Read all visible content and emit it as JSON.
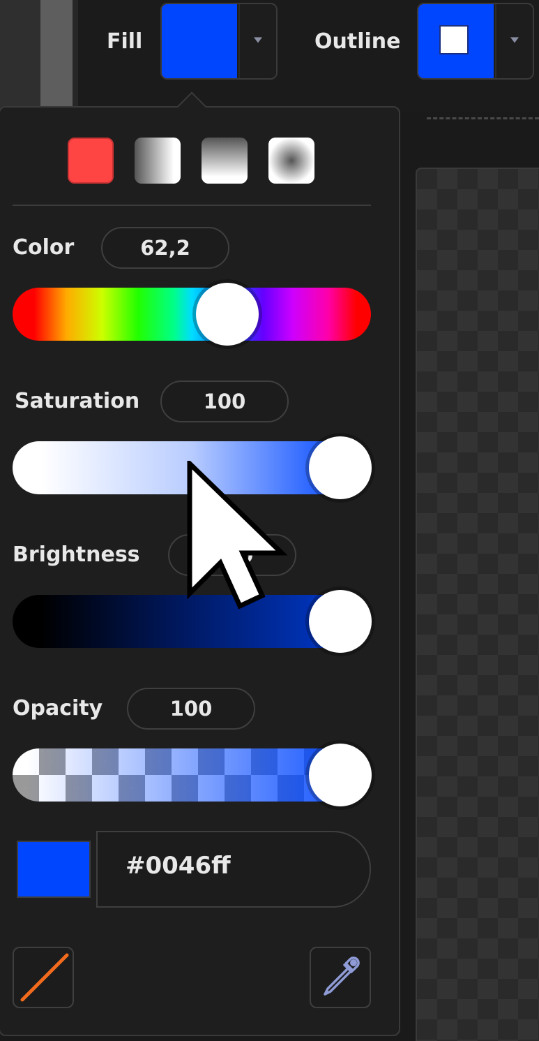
{
  "toolbar": {
    "fill_label": "Fill",
    "outline_label": "Outline",
    "fill_color": "#0046ff",
    "outline_color": "#0046ff",
    "outline_inner_color": "#ffffff"
  },
  "picker": {
    "gradient_types": [
      {
        "name": "solid",
        "color": "#ff4444"
      },
      {
        "name": "horizontal-gradient"
      },
      {
        "name": "vertical-gradient"
      },
      {
        "name": "radial-gradient"
      }
    ],
    "color": {
      "label": "Color",
      "value": "62,2",
      "level": 0.62
    },
    "saturation": {
      "label": "Saturation",
      "value": "100",
      "level": 1.0
    },
    "brightness": {
      "label": "Brightness",
      "value": "100",
      "level": 1.0
    },
    "opacity": {
      "label": "Opacity",
      "value": "100",
      "level": 1.0
    },
    "hex_value": "#0046ff",
    "preview_color": "#0046ff",
    "icons": [
      "no-fill-icon",
      "eyedropper-icon"
    ]
  }
}
